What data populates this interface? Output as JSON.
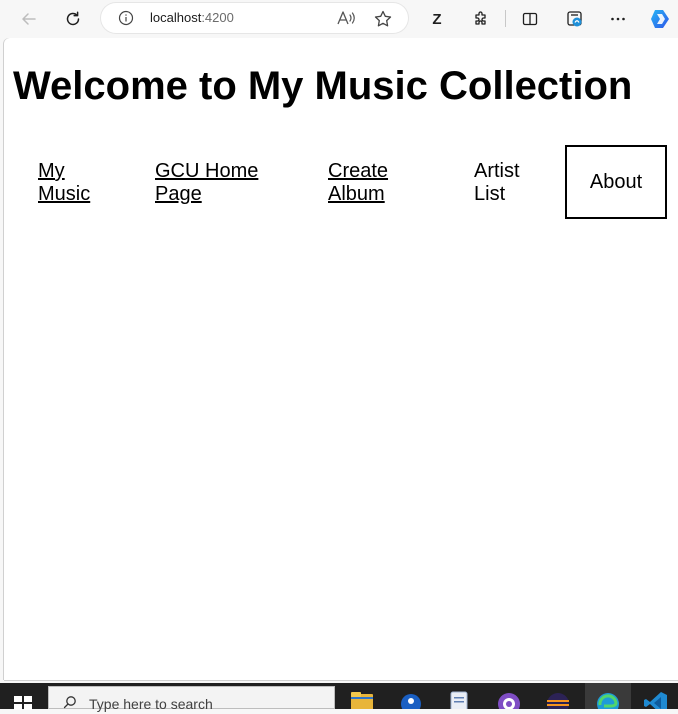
{
  "browser": {
    "url_host": "localhost",
    "url_port": ":4200",
    "read_aloud_glyph": "A̦",
    "profile_letter": "Z"
  },
  "page": {
    "title": "Welcome to My Music Collection",
    "nav": [
      {
        "line1": "My",
        "line2": "Music"
      },
      {
        "line1": "GCU Home",
        "line2": "Page"
      },
      {
        "line1": "Create",
        "line2": "Album"
      },
      {
        "line1": "Artist",
        "line2": "List"
      },
      {
        "label": "About"
      }
    ]
  },
  "taskbar": {
    "search_placeholder": "Type here to search"
  },
  "icons": {
    "back": "back-arrow-icon",
    "refresh": "refresh-icon",
    "info": "info-icon",
    "read_aloud": "read-aloud-icon",
    "favorite": "star-icon",
    "extensions": "puzzle-icon",
    "split": "split-screen-icon",
    "collections": "collections-icon",
    "more": "more-icon",
    "copilot": "copilot-icon"
  },
  "colors": {
    "toolbar_bg": "#f7f7f7",
    "taskbar_bg": "#202020",
    "link": "#000000"
  }
}
